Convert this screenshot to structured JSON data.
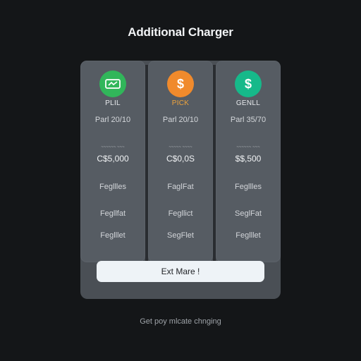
{
  "page": {
    "title": "Additional Charger",
    "footer_text": "Get poy mlcate chnging"
  },
  "plans": [
    {
      "icon": "ticket-icon",
      "icon_color": "#31b65a",
      "name": "PLIL",
      "price_line": "Parl 20/10",
      "amount_label": "~~~~~~ ~~~",
      "amount": "C$5,000",
      "features": [
        "Fegllles",
        "Fegllfat",
        "Feglllet"
      ]
    },
    {
      "icon": "dollar-icon",
      "icon_color": "#f08a2c",
      "name": "PICK",
      "name_color": "#f0a43c",
      "price_line": "Parl 20/10",
      "amount_label": "~~~~~ ~~~~",
      "amount": "C$0,0S",
      "features": [
        "FaglFat",
        "Fegllict",
        "SegFlet"
      ]
    },
    {
      "icon": "dollar-icon",
      "icon_color": "#16b98a",
      "name": "GENLL",
      "price_line": "Parl 35/70",
      "amount_label": "~~~~~~ ~~~",
      "amount": "$$,500",
      "features": [
        "Fegllles",
        "SeglFat",
        "Feglllet"
      ]
    }
  ],
  "cta": {
    "label": "Ext Mare !"
  }
}
